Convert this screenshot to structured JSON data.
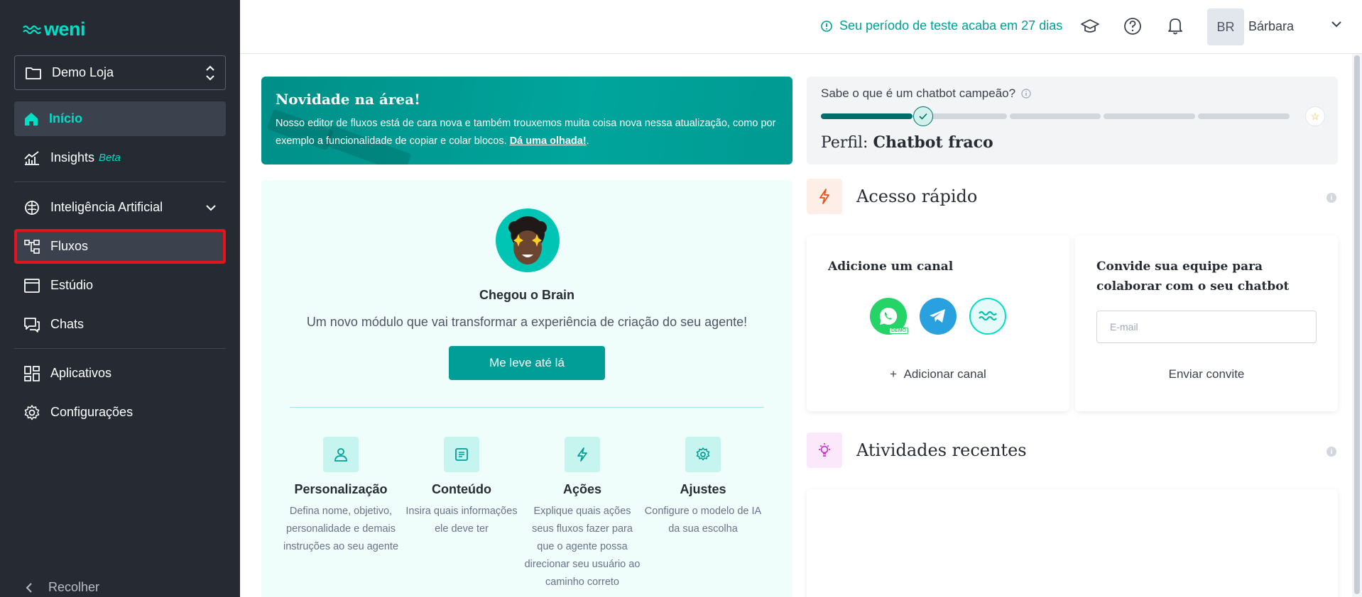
{
  "sidebar": {
    "logo": "weni",
    "project": "Demo Loja",
    "items": {
      "inicio": "Início",
      "insights": "Insights",
      "insights_badge": "Beta",
      "ia": "Inteligência Artificial",
      "fluxos": "Fluxos",
      "estudio": "Estúdio",
      "chats": "Chats",
      "aplicativos": "Aplicativos",
      "configuracoes": "Configurações"
    },
    "collapse": "Recolher"
  },
  "topbar": {
    "trial": "Seu período de teste acaba em 27 dias",
    "avatar_initials": "BR",
    "user_name": "Bárbara"
  },
  "news": {
    "title": "Novidade na área!",
    "text": "Nosso editor de fluxos está de cara nova e também trouxemos muita coisa nova nessa atualização, como por exemplo a funcionalidade de copiar e colar blocos.",
    "link": "Dá uma olhada!",
    "end": "."
  },
  "brain": {
    "title": "Chegou o Brain",
    "subtitle": "Um novo módulo que vai transformar a experiência de criação do seu agente!",
    "button": "Me leve até lá",
    "features": [
      {
        "title": "Personalização",
        "desc": "Defina nome, objetivo, personalidade e demais instruções ao seu agente"
      },
      {
        "title": "Conteúdo",
        "desc": "Insira quais informações ele deve ter"
      },
      {
        "title": "Ações",
        "desc": "Explique quais ações seus fluxos fazer para que o agente possa direcionar seu usuário ao caminho correto"
      },
      {
        "title": "Ajustes",
        "desc": "Configure o modelo de IA da sua escolha"
      }
    ]
  },
  "score": {
    "question": "Sabe o que é um chatbot campeão?",
    "profile_label": "Perfil:",
    "profile_value": "Chatbot fraco",
    "progress_level": 1,
    "progress_total": 5
  },
  "quick_access": {
    "title": "Acesso rápido",
    "add_channel_title": "Adicione um canal",
    "add_channel_link": "Adicionar canal",
    "whatsapp_badge": "DEMO",
    "invite_title": "Convide sua equipe para colaborar com o seu chatbot",
    "email_placeholder": "E-mail",
    "send_invite": "Enviar convite"
  },
  "recent": {
    "title": "Atividades recentes"
  },
  "colors": {
    "sidebar_bg": "#262a33",
    "accent": "#00dec8",
    "primary": "#009e96",
    "highlight_border": "#e3141e"
  }
}
